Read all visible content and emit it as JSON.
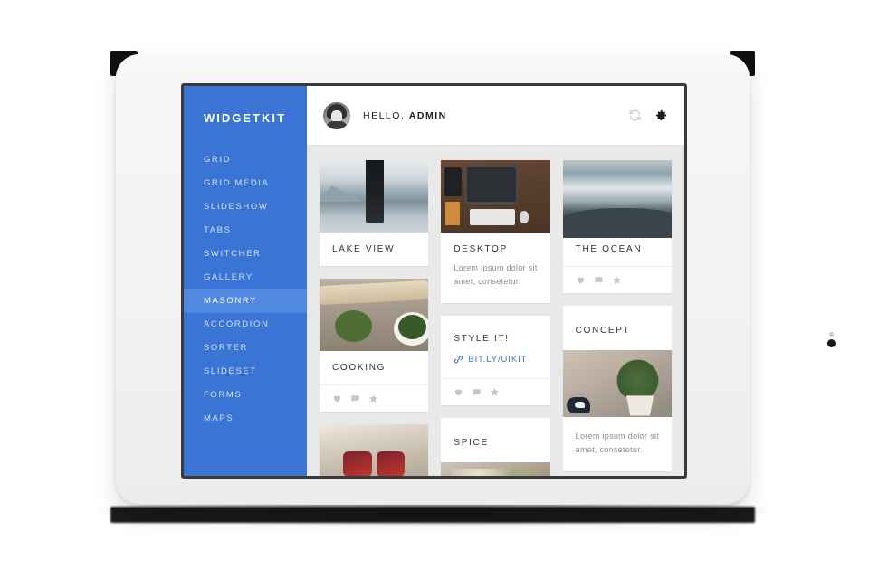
{
  "device": {
    "type": "tablet",
    "home_button": "home-button",
    "camera": "front-camera"
  },
  "sidebar": {
    "brand": "WIDGETKIT",
    "accent_color": "#3a74d4",
    "active_color": "#5189e0",
    "items": [
      {
        "label": "GRID",
        "active": false
      },
      {
        "label": "GRID MEDIA",
        "active": false
      },
      {
        "label": "SLIDESHOW",
        "active": false
      },
      {
        "label": "TABS",
        "active": false
      },
      {
        "label": "SWITCHER",
        "active": false
      },
      {
        "label": "GALLERY",
        "active": false
      },
      {
        "label": "MASONRY",
        "active": true
      },
      {
        "label": "ACCORDION",
        "active": false
      },
      {
        "label": "SORTER",
        "active": false
      },
      {
        "label": "SLIDESET",
        "active": false
      },
      {
        "label": "FORMS",
        "active": false
      },
      {
        "label": "MAPS",
        "active": false
      }
    ]
  },
  "topbar": {
    "greeting_prefix": "HELLO, ",
    "user": "ADMIN",
    "avatar": "user-avatar",
    "refresh_icon": "refresh-icon",
    "settings_icon": "gear-icon"
  },
  "masonry": {
    "background_color": "#e9e9e9",
    "columns": [
      {
        "cards": [
          {
            "title": "LAKE VIEW",
            "image": "lake-view-photo",
            "body": null,
            "link": null,
            "meta": []
          },
          {
            "title": "COOKING",
            "image": "cooking-photo",
            "body": null,
            "link": null,
            "meta": [
              "heart-icon",
              "comment-icon",
              "star-icon"
            ]
          },
          {
            "title": null,
            "image": "sunglasses-photo",
            "body": null,
            "link": null,
            "meta": []
          }
        ]
      },
      {
        "cards": [
          {
            "title": "DESKTOP",
            "image": "desktop-photo",
            "body": "Lorem ipsum dolor sit amet, consetetur.",
            "link": null,
            "meta": []
          },
          {
            "title": "STYLE IT!",
            "image": null,
            "body": null,
            "link": {
              "icon": "link-icon",
              "label": "BIT.LY/UIKIT",
              "color": "#3a74d4"
            },
            "meta": [
              "heart-icon",
              "comment-icon",
              "star-icon"
            ]
          },
          {
            "title": "SPICE",
            "image": "spice-photo",
            "body": null,
            "link": null,
            "meta": []
          }
        ]
      },
      {
        "cards": [
          {
            "title": "THE OCEAN",
            "image": "ocean-photo",
            "body": null,
            "link": null,
            "meta": [
              "heart-icon",
              "comment-icon",
              "star-icon"
            ]
          },
          {
            "title": "CONCEPT",
            "image": "concept-photo",
            "body": "Lorem ipsum dolor sit amet, consetetur.",
            "link": null,
            "meta": []
          }
        ]
      }
    ]
  }
}
